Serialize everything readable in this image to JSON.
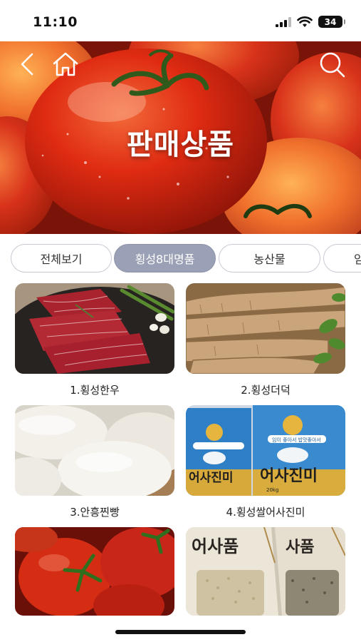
{
  "status_bar": {
    "time": "11:10",
    "battery": "34"
  },
  "hero": {
    "title": "판매상품",
    "icons": [
      "back-icon",
      "home-icon",
      "search-icon"
    ]
  },
  "categories": [
    {
      "label": "전체보기",
      "selected": false
    },
    {
      "label": "횡성8대명품",
      "selected": true
    },
    {
      "label": "농산물",
      "selected": false
    },
    {
      "label": "임",
      "selected": false
    }
  ],
  "products": [
    {
      "label": "1.횡성한우"
    },
    {
      "label": "2.횡성더덕"
    },
    {
      "label": "3.안흥찐빵"
    },
    {
      "label": "4.횡성쌀어사진미"
    },
    {
      "label": ""
    },
    {
      "label": ""
    }
  ],
  "product_images": {
    "rice_bag_brand": "어사진미",
    "rice_bag_tagline": "임이 좋아서 밥맛좋아서",
    "rice_bag_weight": "20kg",
    "grain_bag_brand_left": "어사품",
    "grain_bag_brand_right": "사품"
  },
  "colors": {
    "accent_chip": "#9aa0b5",
    "chip_border": "#c9c9d4",
    "hero_red": "#d22a14"
  }
}
